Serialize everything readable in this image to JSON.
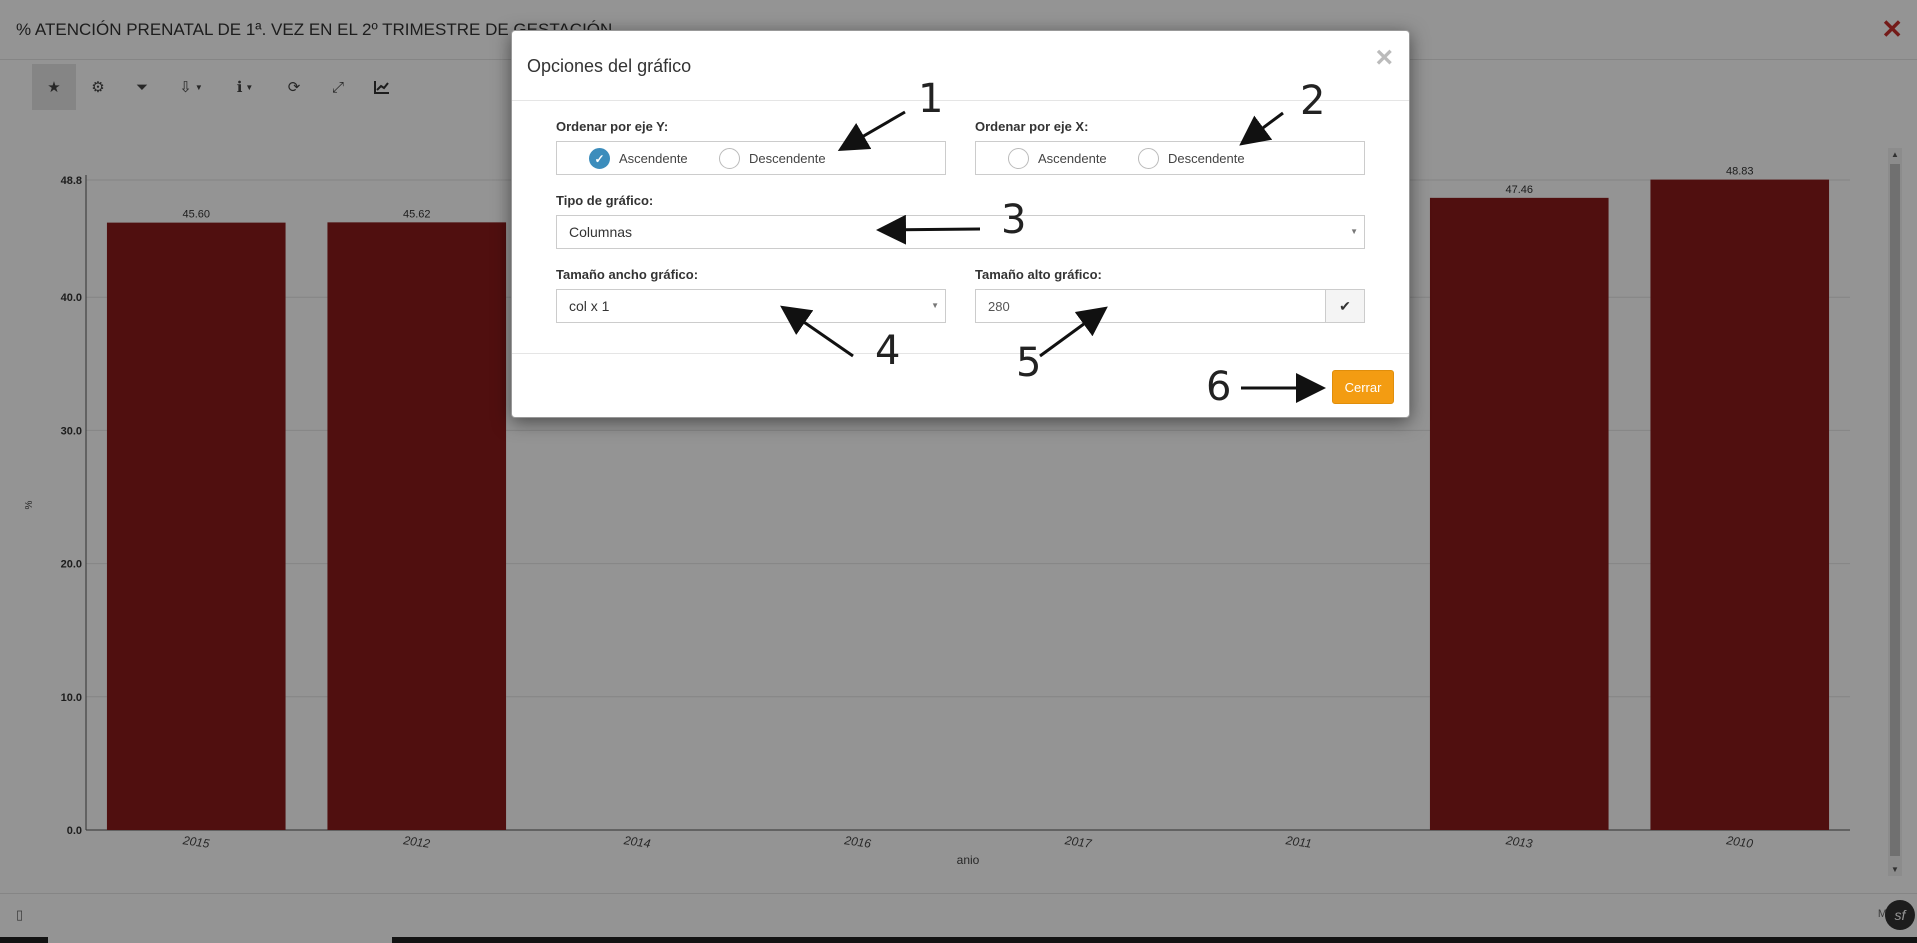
{
  "page": {
    "title": "% ATENCIÓN PRENATAL DE 1ª. VEZ EN EL 2º TRIMESTRE DE GESTACIÓN",
    "close_icon": "times-icon"
  },
  "toolbar": {
    "buttons": [
      {
        "icon": "star-icon",
        "glyph": "★",
        "active": true
      },
      {
        "icon": "gear-icon",
        "glyph": "⚙"
      },
      {
        "icon": "filter-icon",
        "glyph": "⏷"
      },
      {
        "icon": "download-icon",
        "glyph": "⇩",
        "dropdown": true
      },
      {
        "icon": "info-icon",
        "glyph": "ℹ",
        "dropdown": true
      },
      {
        "icon": "refresh-icon",
        "glyph": "⟳"
      },
      {
        "icon": "expand-icon",
        "glyph": "⤢"
      },
      {
        "icon": "line-chart-icon",
        "glyph": "📈"
      }
    ]
  },
  "chart_data": {
    "type": "bar",
    "categories": [
      "2015",
      "2012",
      "2014",
      "2016",
      "2017",
      "2011",
      "2013",
      "2010"
    ],
    "values": [
      45.6,
      45.62,
      null,
      null,
      null,
      null,
      47.46,
      48.83
    ],
    "data_labels": [
      "45.60",
      "45.62",
      "",
      "",
      "",
      "",
      "47.46",
      "48.83"
    ],
    "xlabel": "anio",
    "ylabel": "%",
    "ylim": [
      0,
      48.8
    ],
    "yticks": [
      "0.0",
      "10.0",
      "20.0",
      "30.0",
      "40.0",
      "48.8"
    ],
    "bar_color": "#8b1a1a",
    "grid": true
  },
  "modal": {
    "title": "Opciones del gráfico",
    "close_icon": "×",
    "sort_y": {
      "label": "Ordenar por eje Y:",
      "options": [
        "Ascendente",
        "Descendente"
      ],
      "selected": "Ascendente"
    },
    "sort_x": {
      "label": "Ordenar por eje X:",
      "options": [
        "Ascendente",
        "Descendente"
      ],
      "selected": ""
    },
    "chart_type": {
      "label": "Tipo de gráfico:",
      "value": "Columnas"
    },
    "width_size": {
      "label": "Tamaño ancho gráfico:",
      "value": "col x 1"
    },
    "height_size": {
      "label": "Tamaño alto gráfico:",
      "value": "280",
      "confirm_icon": "check-icon"
    },
    "close_button": "Cerrar"
  },
  "annotations": [
    "1",
    "2",
    "3",
    "4",
    "5",
    "6"
  ],
  "footer": {
    "right_text": "M",
    "badge": "sf"
  },
  "colors": {
    "accent": "#3c8dbc",
    "close_button": "#f39c12",
    "bar": "#8b1a1a",
    "page_close": "#c9302c"
  }
}
